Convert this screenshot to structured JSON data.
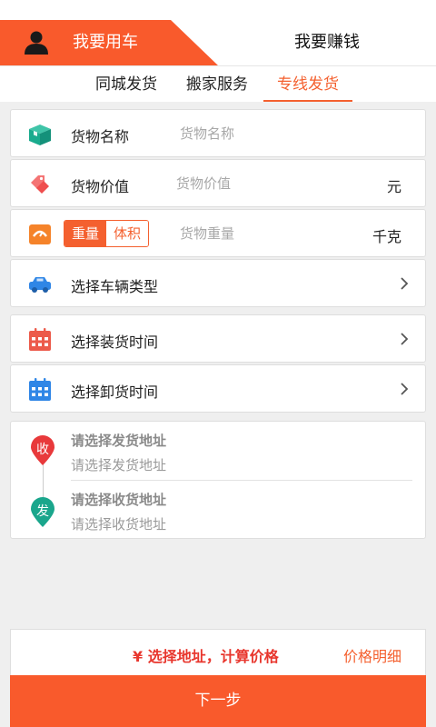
{
  "roles": {
    "active_label": "我要用车",
    "other_label": "我要赚钱"
  },
  "tabs": [
    {
      "label": "同城发货",
      "active": false
    },
    {
      "label": "搬家服务",
      "active": false
    },
    {
      "label": "专线发货",
      "active": true
    }
  ],
  "form": {
    "cargo_name": {
      "label": "货物名称",
      "placeholder": "货物名称"
    },
    "cargo_value": {
      "label": "货物价值",
      "placeholder": "货物价值",
      "unit": "元"
    },
    "cargo_measure": {
      "toggle_weight": "重量",
      "toggle_volume": "体积",
      "selected": "重量",
      "placeholder": "货物重量",
      "unit": "千克"
    },
    "vehicle": {
      "label": "选择车辆类型"
    },
    "load_time": {
      "label": "选择装货时间"
    },
    "unload_time": {
      "label": "选择卸货时间"
    }
  },
  "address": {
    "sender": {
      "marker": "收",
      "title": "请选择发货地址",
      "subtitle": "请选择发货地址",
      "color": "#e8393b"
    },
    "receiver": {
      "marker": "发",
      "title": "请选择收货地址",
      "subtitle": "请选择收货地址",
      "color": "#1aa68c"
    }
  },
  "footer": {
    "price_text": "¥ 选择地址，计算价格",
    "detail_label": "价格明细",
    "next_label": "下一步"
  },
  "colors": {
    "accent": "#f4602f",
    "price": "#e8362d",
    "box_icon": "#1aab8e",
    "tag_icon": "#ef4e4e",
    "scale_icon": "#f5832a",
    "car_icon": "#2f86e6",
    "load_calendar": "#ec5a4a",
    "unload_calendar": "#2f86e6"
  }
}
